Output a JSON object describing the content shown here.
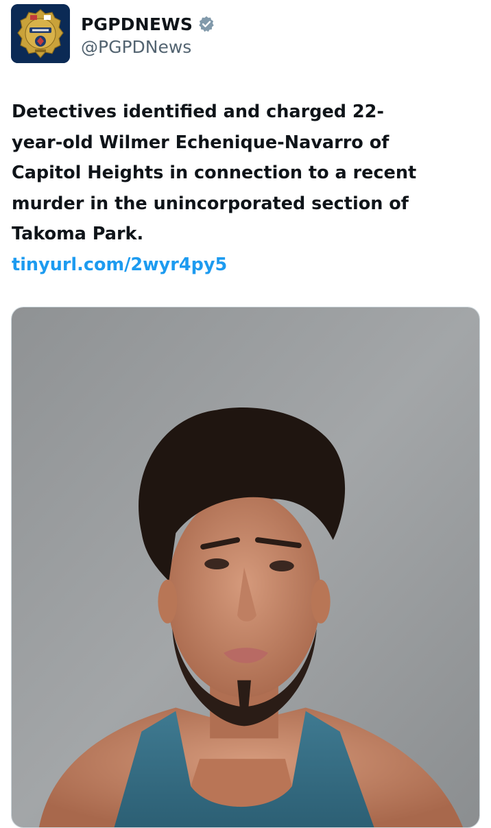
{
  "post": {
    "author": {
      "display_name": "PGPDNEWS",
      "handle": "@PGPDNews",
      "verified": true,
      "avatar_icon": "police-badge-icon",
      "verified_icon": "verified-badge-icon"
    },
    "text": "Detectives identified and charged 22-\nyear-old Wilmer Echenique-Navarro of\nCapitol Heights in connection to a recent\nmurder in the unincorporated section of\nTakoma Park.",
    "link": "tinyurl.com/2wyr4py5",
    "media": {
      "type": "photo",
      "description_icon": "mugshot-photo"
    }
  },
  "colors": {
    "text": "#0f1419",
    "secondary": "#536471",
    "link": "#1d9bf0",
    "verified": "#829aab",
    "badge_gold": "#c9a23a",
    "badge_bg": "#0b2a55"
  }
}
